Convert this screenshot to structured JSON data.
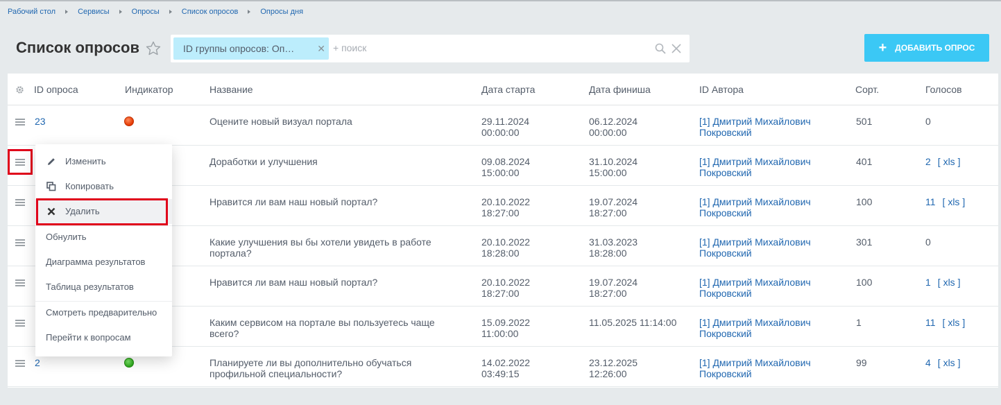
{
  "breadcrumb": [
    "Рабочий стол",
    "Сервисы",
    "Опросы",
    "Список опросов",
    "Опросы дня"
  ],
  "page_title": "Список опросов",
  "filter": {
    "chip_label": "ID группы опросов: Оп…",
    "placeholder": "+ поиск"
  },
  "add_button_label": "ДОБАВИТЬ ОПРОС",
  "columns": [
    "ID опроса",
    "Индикатор",
    "Название",
    "Дата старта",
    "Дата финиша",
    "ID Автора",
    "Сорт.",
    "Голосов"
  ],
  "rows": [
    {
      "id": "23",
      "indicator": "red",
      "title": [
        "Оцените новый визуал портала",
        ""
      ],
      "start": [
        "29.11.2024",
        "00:00:00"
      ],
      "finish": [
        "06.12.2024",
        "00:00:00"
      ],
      "author": [
        "[1] Дмитрий Михайлович",
        "Покровский"
      ],
      "sort": "501",
      "votes": "0",
      "xls": ""
    },
    {
      "id": "",
      "indicator": "",
      "title": [
        "Доработки и улучшения",
        ""
      ],
      "start": [
        "09.08.2024",
        "15:00:00"
      ],
      "finish": [
        "31.10.2024",
        "15:00:00"
      ],
      "author": [
        "[1] Дмитрий Михайлович",
        "Покровский"
      ],
      "sort": "401",
      "votes": "2",
      "xls": "[ xls ]"
    },
    {
      "id": "",
      "indicator": "",
      "title": [
        "Нравится ли вам наш новый портал?",
        ""
      ],
      "start": [
        "20.10.2022",
        "18:27:00"
      ],
      "finish": [
        "19.07.2024",
        "18:27:00"
      ],
      "author": [
        "[1] Дмитрий Михайлович",
        "Покровский"
      ],
      "sort": "100",
      "votes": "11",
      "xls": "[ xls ]"
    },
    {
      "id": "",
      "indicator": "",
      "title": [
        "Какие улучшения вы бы хотели увидеть в работе",
        "портала?"
      ],
      "start": [
        "20.10.2022",
        "18:28:00"
      ],
      "finish": [
        "31.03.2023",
        "18:28:00"
      ],
      "author": [
        "[1] Дмитрий Михайлович",
        "Покровский"
      ],
      "sort": "301",
      "votes": "0",
      "xls": ""
    },
    {
      "id": "",
      "indicator": "",
      "title": [
        "Нравится ли вам наш новый портал?",
        ""
      ],
      "start": [
        "20.10.2022",
        "18:27:00"
      ],
      "finish": [
        "19.07.2024",
        "18:27:00"
      ],
      "author": [
        "[1] Дмитрий Михайлович",
        "Покровский"
      ],
      "sort": "100",
      "votes": "1",
      "xls": "[ xls ]"
    },
    {
      "id": "",
      "indicator": "",
      "title": [
        "Каким сервисом на портале вы пользуетесь чаще",
        "всего?"
      ],
      "start": [
        "15.09.2022",
        "11:00:00"
      ],
      "finish": [
        "11.05.2025 11:14:00",
        ""
      ],
      "author": [
        "[1] Дмитрий Михайлович",
        "Покровский"
      ],
      "sort": "1",
      "votes": "11",
      "xls": "[ xls ]"
    },
    {
      "id": "2",
      "indicator": "green",
      "title": [
        "Планируете ли вы дополнительно обучаться",
        "профильной специальности?"
      ],
      "start": [
        "14.02.2022",
        "03:49:15"
      ],
      "finish": [
        "23.12.2025",
        "12:26:00"
      ],
      "author": [
        "[1] Дмитрий Михайлович",
        "Покровский"
      ],
      "sort": "99",
      "votes": "4",
      "xls": "[ xls ]"
    }
  ],
  "context_menu": {
    "items": [
      "Изменить",
      "Копировать",
      "Удалить",
      "Обнулить",
      "Диаграмма результатов",
      "Таблица результатов",
      "Смотреть предварительно",
      "Перейти к вопросам"
    ],
    "highlighted": "Удалить"
  },
  "colors": {
    "accent": "#3bc8f5",
    "link": "#2067b0",
    "highlight_border": "#e0001a",
    "indicator_red": "#e33700",
    "indicator_green": "#2ea81c"
  }
}
